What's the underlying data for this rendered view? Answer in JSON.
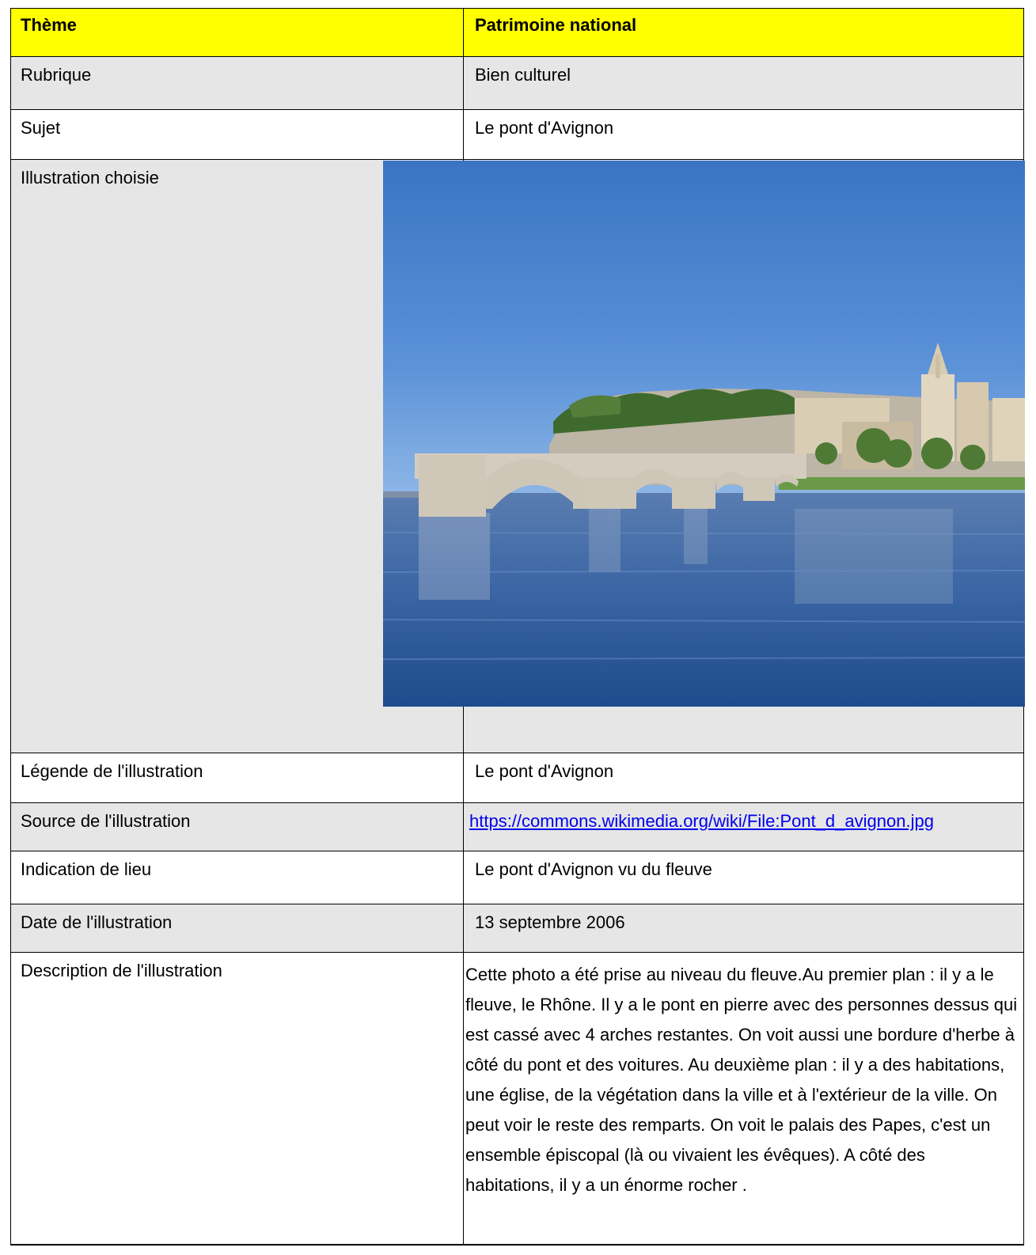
{
  "rows": {
    "theme": {
      "label": "Thème",
      "value": "Patrimoine national"
    },
    "rubrique": {
      "label": "Rubrique",
      "value": "Bien culturel"
    },
    "sujet": {
      "label": "Sujet",
      "value": "Le pont d'Avignon"
    },
    "illustration": {
      "label": "Illustration choisie"
    },
    "legende": {
      "label": "Légende de l'illustration",
      "value": "Le pont d'Avignon"
    },
    "source": {
      "label": "Source de l'illustration",
      "value": " https://commons.wikimedia.org/wiki/File:Pont_d_avignon.jpg"
    },
    "lieu": {
      "label": "Indication de lieu",
      "value": "Le pont d'Avignon vu du fleuve"
    },
    "date": {
      "label": "Date de l'illustration",
      "value": "13 septembre 2006"
    },
    "description": {
      "label": "Description de l'illustration",
      "value": " Cette photo a été prise au niveau du fleuve.Au premier plan : il y a le fleuve, le Rhône. Il y a le pont en pierre avec des personnes dessus qui est cassé avec 4 arches restantes. On voit aussi une bordure d'herbe à côté du pont et des voitures. Au deuxième plan : il y a des habitations, une église, de la végétation dans la ville et à l'extérieur de la ville. On peut voir le reste des remparts. On voit le palais des Papes, c'est un ensemble épiscopal (là ou vivaient les évêques). A côté des habitations, il y a un énorme rocher ."
    }
  },
  "colors": {
    "header": "#ffff00",
    "gray_row": "#e6e6e6",
    "link": "#0000ee"
  }
}
